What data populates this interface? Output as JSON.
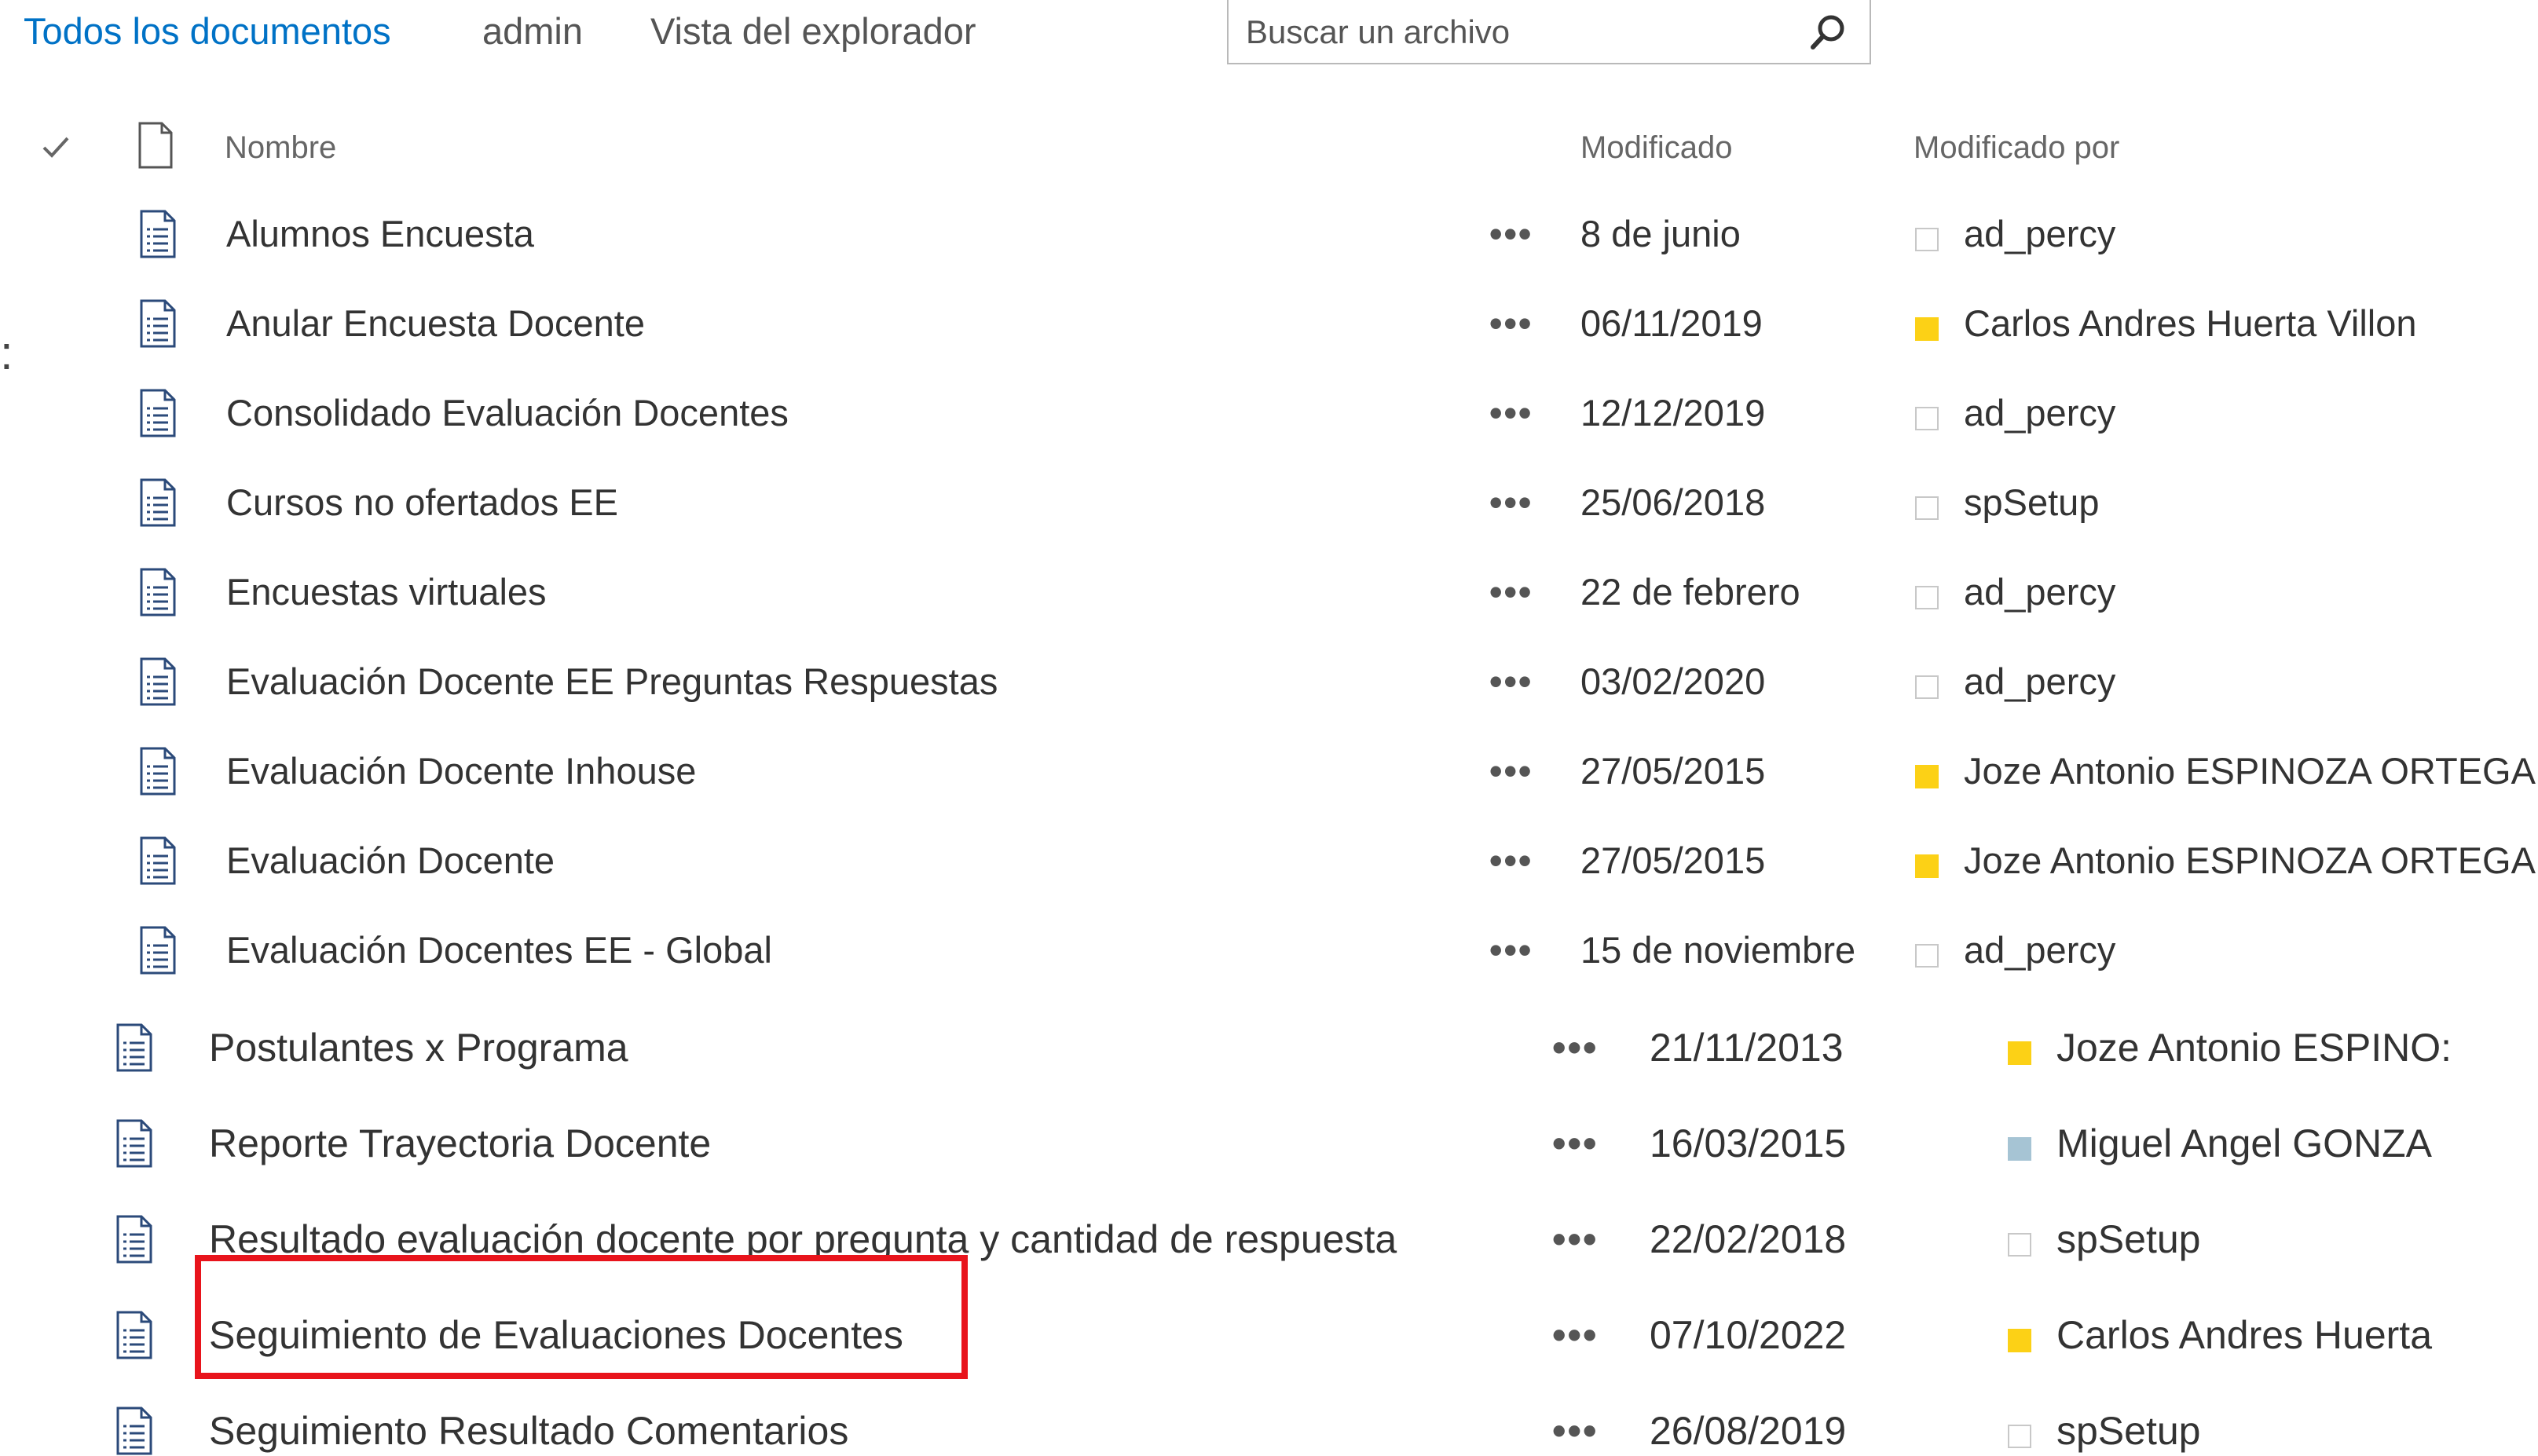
{
  "views": {
    "all_documents": "Todos los documentos",
    "admin": "admin",
    "explorer_view": "Vista del explorador"
  },
  "search": {
    "placeholder": "Buscar un archivo"
  },
  "columns": {
    "name": "Nombre",
    "modified": "Modificado",
    "modified_by": "Modificado por"
  },
  "row_action": "•••",
  "rows": [
    {
      "name": "Alumnos Encuesta",
      "modified": "8 de junio",
      "modified_by": "ad_percy",
      "presence": "none"
    },
    {
      "name": "Anular Encuesta Docente",
      "modified": "06/11/2019",
      "modified_by": "Carlos Andres Huerta Villon",
      "presence": "yellow"
    },
    {
      "name": "Consolidado Evaluación Docentes",
      "modified": "12/12/2019",
      "modified_by": "ad_percy",
      "presence": "none"
    },
    {
      "name": "Cursos no ofertados EE",
      "modified": "25/06/2018",
      "modified_by": "spSetup",
      "presence": "none"
    },
    {
      "name": "Encuestas virtuales",
      "modified": "22 de febrero",
      "modified_by": "ad_percy",
      "presence": "none"
    },
    {
      "name": "Evaluación Docente EE Preguntas Respuestas",
      "modified": "03/02/2020",
      "modified_by": "ad_percy",
      "presence": "none"
    },
    {
      "name": "Evaluación Docente Inhouse",
      "modified": "27/05/2015",
      "modified_by": "Joze Antonio ESPINOZA ORTEGA",
      "presence": "yellow"
    },
    {
      "name": "Evaluación Docente",
      "modified": "27/05/2015",
      "modified_by": "Joze Antonio ESPINOZA ORTEGA",
      "presence": "yellow"
    },
    {
      "name": "Evaluación Docentes EE - Global",
      "modified": "15 de noviembre",
      "modified_by": "ad_percy",
      "presence": "none"
    },
    {
      "name": "Postulantes x Programa",
      "modified": "21/11/2013",
      "modified_by": "Joze Antonio ESPINO:",
      "presence": "yellow"
    },
    {
      "name": "Reporte Trayectoria Docente",
      "modified": "16/03/2015",
      "modified_by": "Miguel Angel GONZA",
      "presence": "gray"
    },
    {
      "name": "Resultado evaluación docente por pregunta y cantidad de respuesta",
      "modified": "22/02/2018",
      "modified_by": "spSetup",
      "presence": "none"
    },
    {
      "name": "Seguimiento de Evaluaciones Docentes",
      "modified": "07/10/2022",
      "modified_by": "Carlos Andres Huerta",
      "presence": "yellow"
    },
    {
      "name": "Seguimiento Resultado Comentarios",
      "modified": "26/08/2019",
      "modified_by": "spSetup",
      "presence": "none"
    }
  ],
  "colors": {
    "accent": "#0072c6",
    "highlight": "#e8141c",
    "presence_yellow": "#fcd116",
    "presence_gray": "#a6c4d4"
  },
  "icons": {
    "search": "search-icon",
    "check": "check-icon",
    "document": "document-icon",
    "file": "list-document-icon"
  }
}
